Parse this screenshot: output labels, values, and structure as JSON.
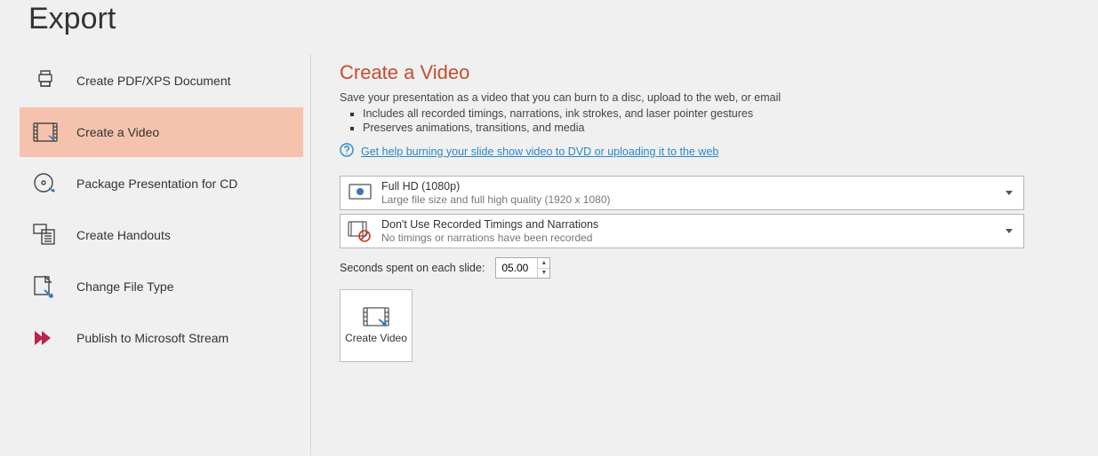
{
  "page_title": "Export",
  "sidebar": {
    "items": [
      {
        "label": "Create PDF/XPS Document"
      },
      {
        "label": "Create a Video"
      },
      {
        "label": "Package Presentation for CD"
      },
      {
        "label": "Create Handouts"
      },
      {
        "label": "Change File Type"
      },
      {
        "label": "Publish to Microsoft Stream"
      }
    ]
  },
  "main": {
    "heading": "Create a Video",
    "description": "Save your presentation as a video that you can burn to a disc, upload to the web, or email",
    "bullets": [
      "Includes all recorded timings, narrations, ink strokes, and laser pointer gestures",
      "Preserves animations, transitions, and media"
    ],
    "help_link": "Get help burning your slide show video to DVD or uploading it to the web",
    "resolution": {
      "title": "Full HD (1080p)",
      "subtitle": "Large file size and full high quality (1920 x 1080)"
    },
    "timings": {
      "title": "Don't Use Recorded Timings and Narrations",
      "subtitle": "No timings or narrations have been recorded"
    },
    "seconds_label": "Seconds spent on each slide:",
    "seconds_value": "05.00",
    "create_button_label": "Create Video"
  }
}
